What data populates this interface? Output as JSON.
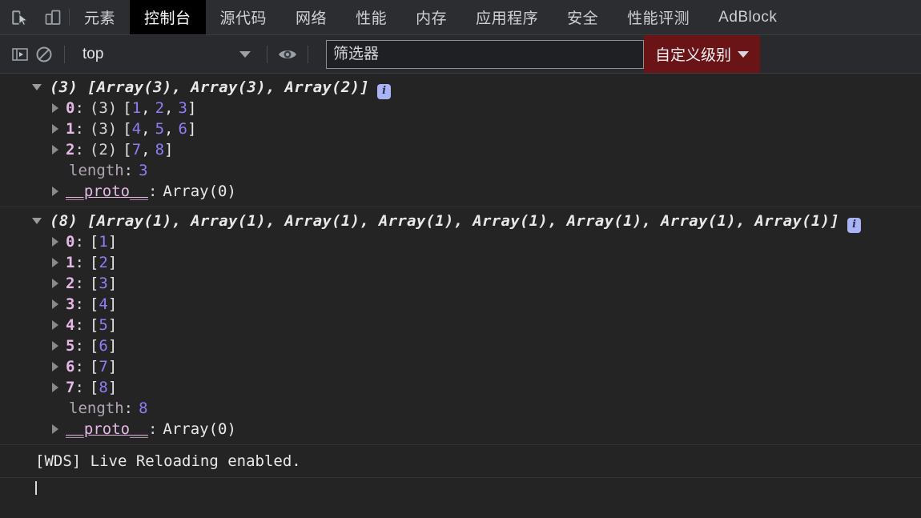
{
  "window": {
    "title": "DevTools - Console"
  },
  "tabbar": {
    "icons": [
      {
        "name": "inspect-element-icon",
        "label": "检查元素"
      },
      {
        "name": "device-toolbar-icon",
        "label": "设备工具栏"
      }
    ],
    "tabs": [
      {
        "label": "元素",
        "active": false
      },
      {
        "label": "控制台",
        "active": true
      },
      {
        "label": "源代码",
        "active": false
      },
      {
        "label": "网络",
        "active": false
      },
      {
        "label": "性能",
        "active": false
      },
      {
        "label": "内存",
        "active": false
      },
      {
        "label": "应用程序",
        "active": false
      },
      {
        "label": "安全",
        "active": false
      },
      {
        "label": "性能评测",
        "active": false
      },
      {
        "label": "AdBlock",
        "active": false
      }
    ]
  },
  "filterbar": {
    "sidebar_toggle": "显示控制台侧边栏",
    "clear_console": "清除控制台",
    "context": {
      "value": "top",
      "caret": "▼"
    },
    "eye_icon": "创建实时表达式",
    "filter": {
      "value": "",
      "placeholder": "筛选器"
    },
    "level": {
      "label": "自定义级别",
      "caret": "▼",
      "color": "#6b1418"
    }
  },
  "console": {
    "groups": [
      {
        "summary": "(3) [Array(3), Array(3), Array(2)]",
        "badge": "i",
        "expanded": true,
        "rows": [
          {
            "type": "entry",
            "key": "0",
            "count": "(3)",
            "values": [
              "1",
              "2",
              "3"
            ]
          },
          {
            "type": "entry",
            "key": "1",
            "count": "(3)",
            "values": [
              "4",
              "5",
              "6"
            ]
          },
          {
            "type": "entry",
            "key": "2",
            "count": "(2)",
            "values": [
              "7",
              "8"
            ]
          },
          {
            "type": "length",
            "key": "length",
            "value": "3"
          },
          {
            "type": "proto",
            "key": "__proto__",
            "value": "Array(0)"
          }
        ]
      },
      {
        "summary": "(8) [Array(1), Array(1), Array(1), Array(1), Array(1), Array(1), Array(1), Array(1)]",
        "badge": "i",
        "expanded": true,
        "rows": [
          {
            "type": "entry",
            "key": "0",
            "count": "",
            "values": [
              "1"
            ]
          },
          {
            "type": "entry",
            "key": "1",
            "count": "",
            "values": [
              "2"
            ]
          },
          {
            "type": "entry",
            "key": "2",
            "count": "",
            "values": [
              "3"
            ]
          },
          {
            "type": "entry",
            "key": "3",
            "count": "",
            "values": [
              "4"
            ]
          },
          {
            "type": "entry",
            "key": "4",
            "count": "",
            "values": [
              "5"
            ]
          },
          {
            "type": "entry",
            "key": "5",
            "count": "",
            "values": [
              "6"
            ]
          },
          {
            "type": "entry",
            "key": "6",
            "count": "",
            "values": [
              "7"
            ]
          },
          {
            "type": "entry",
            "key": "7",
            "count": "",
            "values": [
              "8"
            ]
          },
          {
            "type": "length",
            "key": "length",
            "value": "8"
          },
          {
            "type": "proto",
            "key": "__proto__",
            "value": "Array(0)"
          }
        ]
      }
    ],
    "log_message": "[WDS] Live Reloading enabled.",
    "prompt_value": ""
  },
  "colors": {
    "background": "#242424",
    "toolbar": "#282a2d",
    "tabbar": "#2b2d31",
    "active_tab": "#000000",
    "number": "#8d7ff5",
    "key": "#e5b8e5",
    "level_button": "#6b1418",
    "badge": "#a9b4f5"
  }
}
